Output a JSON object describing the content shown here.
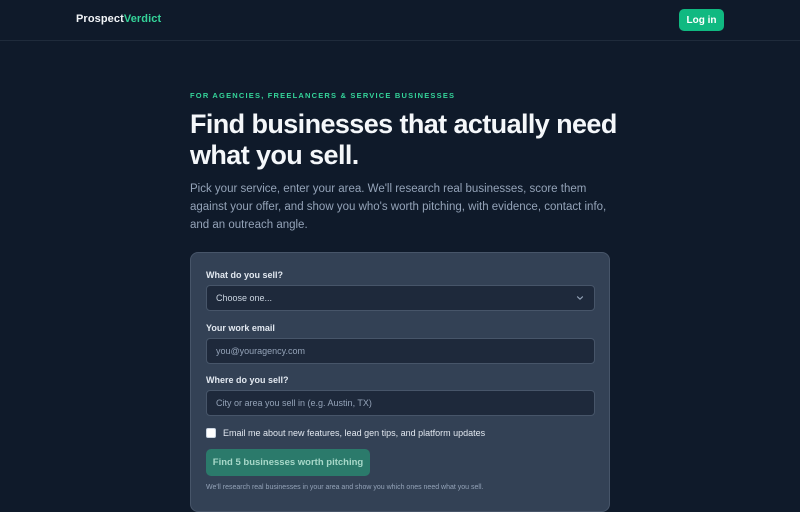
{
  "header": {
    "brand_part1": "Prospect",
    "brand_part2": "Verdict",
    "login_label": "Log in"
  },
  "hero": {
    "eyebrow": "FOR AGENCIES, FREELANCERS & SERVICE BUSINESSES",
    "headline": "Find businesses that actually need what you sell.",
    "subtext": "Pick your service, enter your area. We'll research real businesses, score them against your offer, and show you who's worth pitching, with evidence, contact info, and an outreach angle."
  },
  "form": {
    "service_label": "What do you sell?",
    "service_selected": "Choose one...",
    "email_label": "Your work email",
    "email_placeholder": "you@youragency.com",
    "area_label": "Where do you sell?",
    "area_placeholder": "City or area you sell in (e.g. Austin, TX)",
    "updates_checkbox_label": "Email me about new features, lead gen tips, and platform updates",
    "updates_checked": false,
    "submit_label": "Find 5 businesses worth pitching",
    "footnote": "We'll research real businesses in your area and show you which ones need what you sell."
  },
  "colors": {
    "background": "#0f1a2a",
    "accent": "#10b981",
    "accent_text": "#34d399",
    "card": "#334155"
  },
  "icons": {
    "select_chevron": "chevron-down-icon"
  }
}
